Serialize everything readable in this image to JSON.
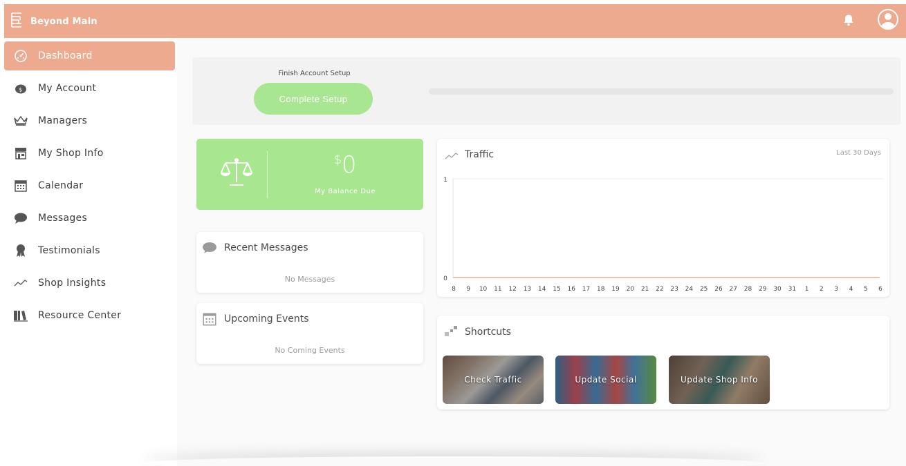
{
  "app": {
    "brand_name": "Beyond Main"
  },
  "colors": {
    "accent": "#eeaa8e",
    "green": "#a8e78f",
    "line": "#eeaa8e"
  },
  "topbar": {
    "icons": [
      "bell-icon",
      "user-avatar-icon"
    ]
  },
  "sidebar": {
    "items": [
      {
        "label": "Dashboard",
        "icon": "dashboard-icon",
        "active": true
      },
      {
        "label": "My Account",
        "icon": "piggy-bank-icon"
      },
      {
        "label": "Managers",
        "icon": "crown-icon"
      },
      {
        "label": "My Shop Info",
        "icon": "shop-icon"
      },
      {
        "label": "Calendar",
        "icon": "calendar-icon"
      },
      {
        "label": "Messages",
        "icon": "chat-icon"
      },
      {
        "label": "Testimonials",
        "icon": "award-icon"
      },
      {
        "label": "Shop Insights",
        "icon": "trend-line-icon"
      },
      {
        "label": "Resource Center",
        "icon": "book-icon"
      }
    ]
  },
  "setup": {
    "title": "Finish Account Setup",
    "button_label": "Complete Setup",
    "progress": 0
  },
  "balance": {
    "currency": "$",
    "amount": "0",
    "label": "My Balance Due"
  },
  "messages": {
    "title": "Recent Messages",
    "empty": "No Messages"
  },
  "events": {
    "title": "Upcoming Events",
    "empty": "No Coming Events"
  },
  "traffic": {
    "title": "Traffic",
    "range": "Last 30 Days"
  },
  "chart_data": {
    "type": "line",
    "title": "Traffic",
    "x": [
      "8",
      "9",
      "10",
      "11",
      "12",
      "13",
      "14",
      "15",
      "16",
      "17",
      "18",
      "19",
      "20",
      "21",
      "22",
      "23",
      "24",
      "25",
      "26",
      "27",
      "28",
      "29",
      "30",
      "31",
      "1",
      "2",
      "3",
      "4",
      "5",
      "6"
    ],
    "series": [
      {
        "values": [
          0,
          0,
          0,
          0,
          0,
          0,
          0,
          0,
          0,
          0,
          0,
          0,
          0,
          0,
          0,
          0,
          0,
          0,
          0,
          0,
          0,
          0,
          0,
          0,
          0,
          0,
          0,
          0,
          0,
          0
        ]
      }
    ],
    "ylim": [
      0,
      1
    ],
    "yticks": [
      "1",
      "0"
    ],
    "grid": true
  },
  "shortcuts": {
    "title": "Shortcuts",
    "items": [
      {
        "label": "Check Traffic"
      },
      {
        "label": "Update Social"
      },
      {
        "label": "Update Shop Info"
      }
    ]
  }
}
